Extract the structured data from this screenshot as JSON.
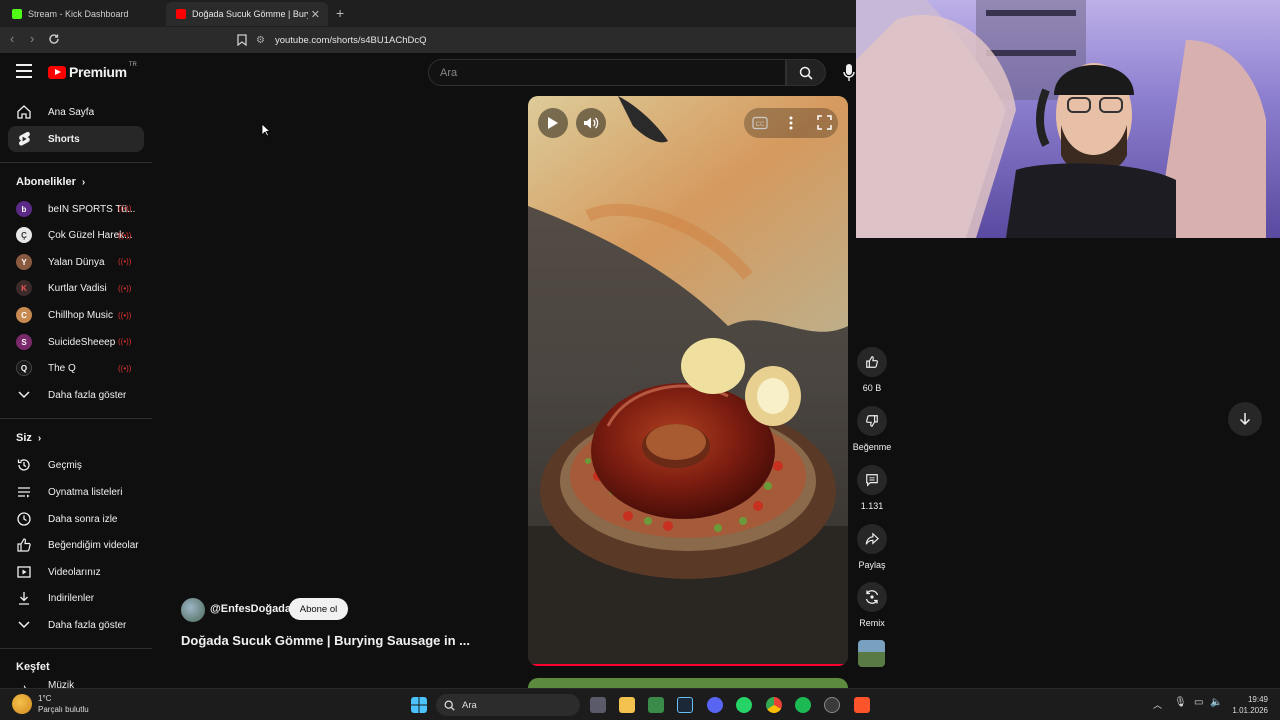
{
  "browser": {
    "tabs": [
      {
        "title": "Stream - Kick Dashboard",
        "favicon_color": "#53fc18"
      },
      {
        "title": "Doğada Sucuk Gömme | Burying",
        "favicon_color": "#ff0000"
      }
    ],
    "url": "youtube.com/shorts/s4BU1AChDcQ"
  },
  "header": {
    "logo_text": "Premium",
    "logo_sup": "TR",
    "search_placeholder": "Ara"
  },
  "sidebar": {
    "main": [
      {
        "label": "Ana Sayfa",
        "icon": "home-icon"
      },
      {
        "label": "Shorts",
        "icon": "shorts-icon",
        "active": true
      }
    ],
    "subs_title": "Abonelikler",
    "subscriptions": [
      {
        "label": "beIN SPORTS Tü...",
        "avatar_color": "#5b2a86",
        "avatar_text": "b"
      },
      {
        "label": "Çok Güzel Harek...",
        "avatar_color": "#e8e8e8",
        "avatar_text": "Ç"
      },
      {
        "label": "Yalan Dünya",
        "avatar_color": "#8a5a40",
        "avatar_text": "Y"
      },
      {
        "label": "Kurtlar Vadisi",
        "avatar_color": "#3a2a2a",
        "avatar_text": "K"
      },
      {
        "label": "Chillhop Music",
        "avatar_color": "#c78a50",
        "avatar_text": "C"
      },
      {
        "label": "SuicideSheeep",
        "avatar_color": "#7a2a6a",
        "avatar_text": "S"
      },
      {
        "label": "The Q",
        "avatar_color": "#1a1a1a",
        "avatar_text": "Q"
      }
    ],
    "subs_more": "Daha fazla göster",
    "you_title": "Siz",
    "you_items": [
      {
        "label": "Geçmiş",
        "icon": "history-icon"
      },
      {
        "label": "Oynatma listeleri",
        "icon": "playlist-icon"
      },
      {
        "label": "Daha sonra izle",
        "icon": "clock-icon"
      },
      {
        "label": "Beğendiğim videolar",
        "icon": "like-icon"
      },
      {
        "label": "Videolarınız",
        "icon": "video-icon"
      },
      {
        "label": "İndirilenler",
        "icon": "download-icon"
      }
    ],
    "you_more": "Daha fazla göster",
    "explore_title": "Keşfet",
    "explore_partial": "Müzik"
  },
  "video": {
    "channel": "@EnfesDoğada",
    "subscribe": "Abone ol",
    "title": "Doğada Sucuk Gömme | Burying Sausage in ..."
  },
  "actions": {
    "likes": "60 B",
    "dislike": "Beğenme",
    "comments": "1.131",
    "share": "Paylaş",
    "remix": "Remix"
  },
  "taskbar": {
    "weather_temp": "1°C",
    "weather_desc": "Parçalı bulutlu",
    "search": "Ara",
    "time": "19:49",
    "date": "1.01.2026"
  }
}
